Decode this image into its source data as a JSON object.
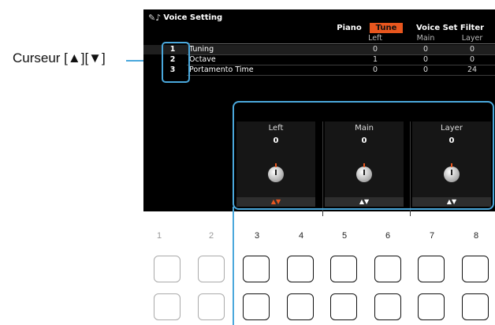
{
  "callout": {
    "text": "Curseur [▲][▼]"
  },
  "screen": {
    "title": "Voice Setting",
    "title_icon": "voice-instrument-icon",
    "tabs": [
      {
        "label": "Piano",
        "active": false
      },
      {
        "label": "Tune",
        "active": true
      },
      {
        "label": "Voice Set Filter",
        "active": false
      }
    ],
    "columns": [
      "Left",
      "Main",
      "Layer"
    ],
    "rows": [
      {
        "num": "1",
        "label": "Tuning",
        "left": "0",
        "main": "0",
        "layer": "0"
      },
      {
        "num": "2",
        "label": "Octave",
        "left": "1",
        "main": "0",
        "layer": "0"
      },
      {
        "num": "3",
        "label": "Portamento Time",
        "left": "0",
        "main": "0",
        "layer": "24"
      }
    ],
    "panels": [
      {
        "title": "Left",
        "value": "0",
        "arrows": "▲▼",
        "active": true
      },
      {
        "title": "Main",
        "value": "0",
        "arrows": "▲▼",
        "active": false
      },
      {
        "title": "Layer",
        "value": "0",
        "arrows": "▲▼",
        "active": false
      }
    ]
  },
  "buttons": {
    "numbers": [
      "1",
      "2",
      "3",
      "4",
      "5",
      "6",
      "7",
      "8"
    ],
    "accent": "#4aa8dc",
    "highlight": "#e8561e"
  }
}
